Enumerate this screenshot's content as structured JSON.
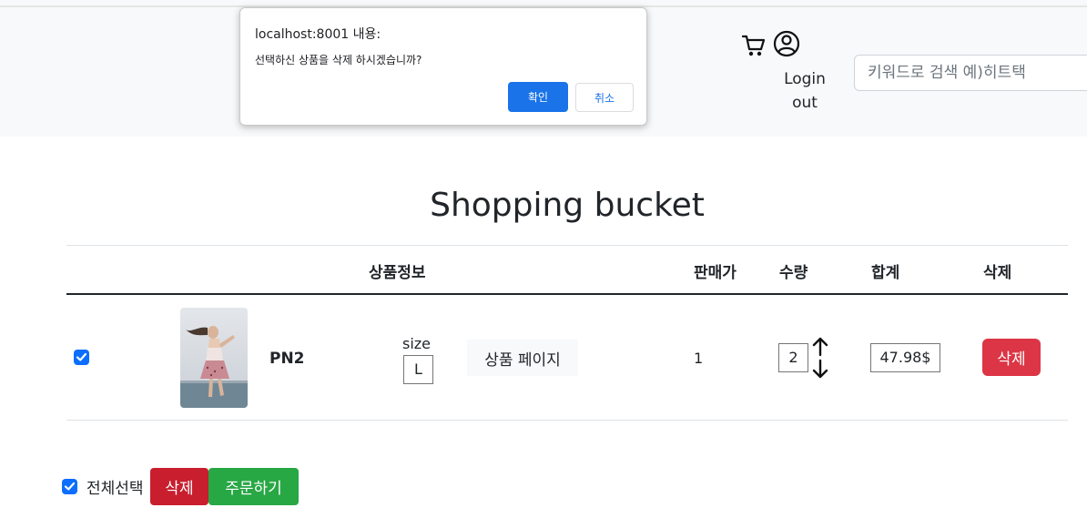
{
  "header": {
    "login_line1": "Login",
    "login_line2": "out",
    "search_placeholder": "키워드로 검색 예)히트택"
  },
  "dialog": {
    "title": "localhost:8001 내용:",
    "message": "선택하신 상품을 삭제 하시겠습니까?",
    "ok_label": "확인",
    "cancel_label": "취소"
  },
  "page": {
    "title": "Shopping bucket"
  },
  "table": {
    "headers": {
      "info": "상품정보",
      "price": "판매가",
      "qty": "수량",
      "total": "합계",
      "delete": "삭제"
    },
    "rows": [
      {
        "checked": true,
        "name": "PN2",
        "size_label": "size",
        "size": "L",
        "page_button": "상품 페이지",
        "price": "1",
        "quantity": "2",
        "total": "47.98$",
        "delete_label": "삭제"
      }
    ]
  },
  "footer": {
    "select_all_label": "전체선택",
    "select_all_checked": true,
    "delete_label": "삭제",
    "order_label": "주문하기"
  },
  "colors": {
    "primary": "#0d6efd",
    "danger": "#dc3545",
    "success": "#28a745",
    "dialog_ok": "#1a73e8"
  }
}
